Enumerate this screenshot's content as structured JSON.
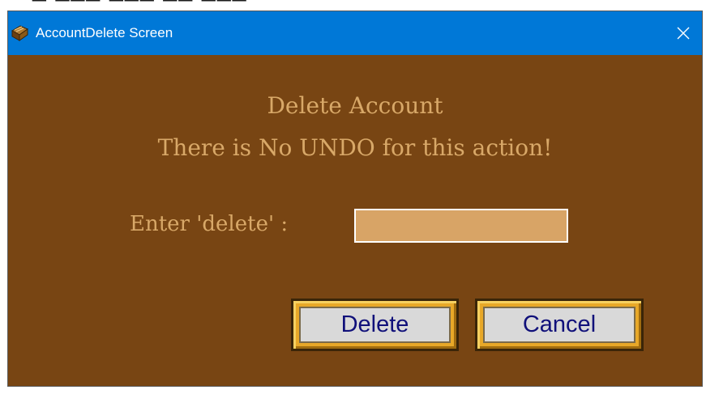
{
  "window": {
    "title": "AccountDelete Screen",
    "app_icon": "app-book-icon",
    "close_icon": "close-icon"
  },
  "dialog": {
    "heading": "Delete Account",
    "warning": "There is No UNDO for this action!",
    "prompt_label": "Enter 'delete' :",
    "input_value": "",
    "delete_label": "Delete",
    "cancel_label": "Cancel"
  },
  "colors": {
    "background": "#784513",
    "titlebar": "#0078d7",
    "text": "#d8a868",
    "input_fill": "#d8a466",
    "button_frame": "#e8a828",
    "button_face": "#d9d9d9",
    "button_text": "#10107a"
  }
}
